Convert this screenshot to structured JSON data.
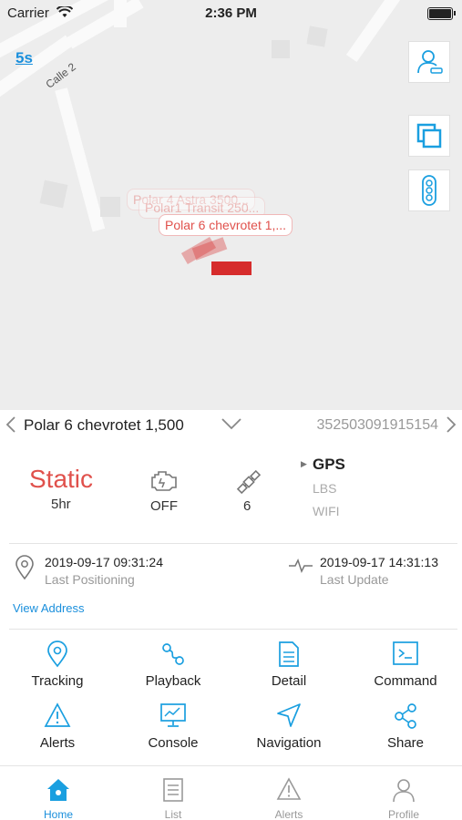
{
  "status_bar": {
    "carrier": "Carrier",
    "time": "2:36 PM"
  },
  "map": {
    "refresh_interval": "5s",
    "street_name": "Calle 2",
    "markers": [
      {
        "label": "Polar 4 Astra 3500..."
      },
      {
        "label": "Polar1 Transit 250..."
      },
      {
        "label": "Polar 6 chevrotet 1,..."
      }
    ],
    "buttons": [
      "profile-car-icon",
      "layers-icon",
      "traffic-light-icon"
    ]
  },
  "device": {
    "name": "Polar 6 chevrotet 1,500",
    "imei": "352503091915154",
    "status": "Static",
    "status_duration": "5hr",
    "acc": "OFF",
    "satellites": "6",
    "positioning": {
      "gps": "GPS",
      "lbs": "LBS",
      "wifi": "WIFI"
    },
    "last_positioning_time": "2019-09-17 09:31:24",
    "last_positioning_label": "Last Positioning",
    "last_update_time": "2019-09-17 14:31:13",
    "last_update_label": "Last Update",
    "view_address": "View Address"
  },
  "functions": [
    {
      "label": "Tracking",
      "icon": "location-pin-icon"
    },
    {
      "label": "Playback",
      "icon": "route-icon"
    },
    {
      "label": "Detail",
      "icon": "document-icon"
    },
    {
      "label": "Command",
      "icon": "terminal-icon"
    },
    {
      "label": "Alerts",
      "icon": "warning-icon"
    },
    {
      "label": "Console",
      "icon": "monitor-chart-icon"
    },
    {
      "label": "Navigation",
      "icon": "navigation-arrow-icon"
    },
    {
      "label": "Share",
      "icon": "share-icon"
    }
  ],
  "tabs": [
    {
      "label": "Home",
      "icon": "home-icon",
      "active": true
    },
    {
      "label": "List",
      "icon": "list-icon",
      "active": false
    },
    {
      "label": "Alerts",
      "icon": "warning-icon",
      "active": false
    },
    {
      "label": "Profile",
      "icon": "person-icon",
      "active": false
    }
  ],
  "colors": {
    "accent": "#1a8fdc",
    "status_red": "#e0514c",
    "icon_blue": "#1a9fe0"
  }
}
